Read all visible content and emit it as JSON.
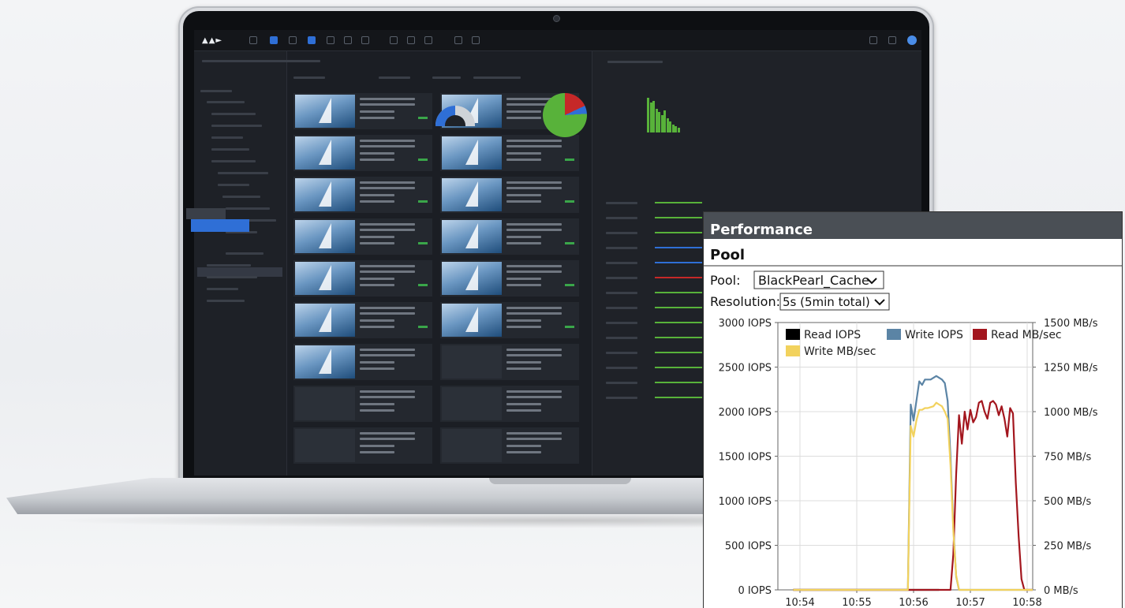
{
  "performance": {
    "header": "Performance",
    "section": "Pool",
    "pool_label": "Pool:",
    "pool_value": "BlackPearl_Cache",
    "resolution_label": "Resolution:",
    "resolution_value": "5s (5min total)",
    "colors": {
      "read_iops": "#000000",
      "write_iops": "#5b84a5",
      "read_mbsec": "#a3161e",
      "write_mbsec": "#f2d25d"
    }
  },
  "chart_data": {
    "type": "line",
    "x_ticks": [
      "10:54",
      "10:55",
      "10:56",
      "10:57",
      "10:58"
    ],
    "y_left_ticks": [
      "3000 IOPS",
      "2500 IOPS",
      "2000 IOPS",
      "1500 IOPS",
      "1000 IOPS",
      "500 IOPS",
      "0 IOPS"
    ],
    "y_right_ticks": [
      "1500 MB/s",
      "1250 MB/s",
      "1000 MB/s",
      "750 MB/s",
      "500 MB/s",
      "250 MB/s",
      "0 MB/s"
    ],
    "y_left_range": [
      0,
      3000
    ],
    "y_right_range": [
      0,
      1500
    ],
    "x_range_minutes": [
      -0.12,
      2.45
    ],
    "grid": true,
    "legend_position": "top",
    "series": [
      {
        "name": "Read IOPS",
        "axis": "left",
        "x": [
          -0.12,
          2.45
        ],
        "y": [
          0,
          0
        ]
      },
      {
        "name": "Write IOPS",
        "axis": "left",
        "x": [
          -0.12,
          1.9,
          1.95,
          2.0,
          2.05,
          2.1,
          2.15,
          2.2,
          2.25,
          2.3,
          2.35,
          2.4,
          2.45,
          2.5,
          2.55,
          2.6,
          2.65,
          2.7,
          2.75,
          2.8,
          2.85,
          2.9,
          2.95,
          3.0,
          3.05,
          4.45
        ],
        "y": [
          0,
          0,
          2080,
          1900,
          2120,
          2340,
          2300,
          2360,
          2360,
          2360,
          2380,
          2400,
          2380,
          2360,
          2320,
          2120,
          1500,
          700,
          150,
          0,
          0,
          0,
          0,
          0,
          0,
          0
        ]
      },
      {
        "name": "Read MB/sec",
        "axis": "right",
        "x": [
          -0.12,
          2.65,
          2.7,
          2.75,
          2.8,
          2.85,
          2.9,
          2.95,
          3.0,
          3.05,
          3.1,
          3.15,
          3.2,
          3.25,
          3.3,
          3.35,
          3.4,
          3.45,
          3.5,
          3.55,
          3.6,
          3.65,
          3.7,
          3.75,
          3.8,
          3.85,
          3.9,
          3.95,
          4.0,
          4.45
        ],
        "y": [
          0,
          0,
          200,
          650,
          980,
          820,
          1000,
          900,
          1010,
          940,
          970,
          1050,
          1060,
          1000,
          960,
          1050,
          1060,
          1040,
          980,
          1030,
          960,
          860,
          1020,
          990,
          600,
          300,
          60,
          0,
          0,
          0
        ]
      },
      {
        "name": "Write MB/sec",
        "axis": "right",
        "x": [
          -0.12,
          1.9,
          1.95,
          2.0,
          2.05,
          2.1,
          2.15,
          2.2,
          2.25,
          2.3,
          2.35,
          2.4,
          2.45,
          2.5,
          2.55,
          2.6,
          2.65,
          2.7,
          2.75,
          2.8,
          2.85,
          2.9,
          4.45
        ],
        "y": [
          0,
          0,
          920,
          860,
          950,
          1010,
          1010,
          1020,
          1020,
          1025,
          1030,
          1050,
          1040,
          1030,
          1000,
          960,
          700,
          330,
          80,
          0,
          0,
          0,
          0
        ]
      }
    ]
  }
}
